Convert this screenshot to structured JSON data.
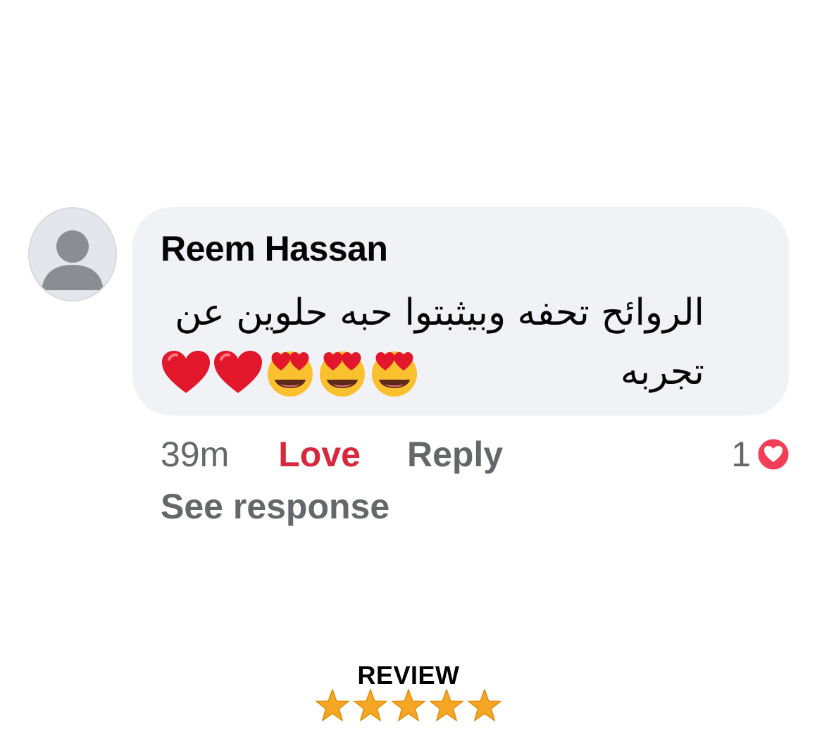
{
  "comment": {
    "author": "Reem Hassan",
    "text": "الروائح تحفه وبيثبتوا حبه حلوين عن تجربه",
    "emojis": [
      "heart-eyes-emoji",
      "heart-eyes-emoji",
      "heart-eyes-emoji",
      "red-heart-emoji",
      "red-heart-emoji"
    ],
    "avatar_icon": "default-profile-avatar-icon"
  },
  "actions": {
    "timestamp": "39m",
    "love_label": "Love",
    "reply_label": "Reply",
    "see_response_label": "See response"
  },
  "reactions": {
    "count": "1",
    "icon": "love-reaction-icon"
  },
  "review": {
    "label": "REVIEW",
    "stars": 5,
    "star_icon": "star-icon"
  },
  "colors": {
    "love_red": "#d7283e",
    "bubble_bg": "#f0f2f5",
    "muted_text": "#65676b",
    "star_gold": "#f5a623"
  }
}
